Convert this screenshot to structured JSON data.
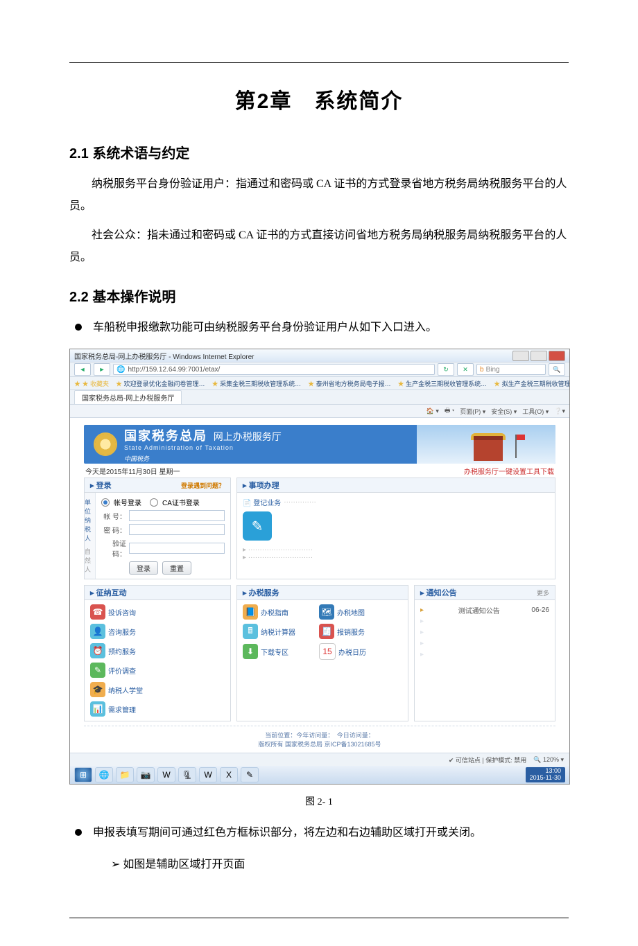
{
  "doc": {
    "chapter_title": "第2章　系统简介",
    "s21": "2.1 系统术语与约定",
    "p1": "纳税服务平台身份验证用户：指通过和密码或 CA 证书的方式登录省地方税务局纳税服务平台的人员。",
    "p2": "社会公众：指未通过和密码或 CA 证书的方式直接访问省地方税务局纳税服务局纳税服务平台的人员。",
    "s22": "2.2 基本操作说明",
    "b1": "车船税申报缴款功能可由纳税服务平台身份验证用户从如下入口进入。",
    "caption": "图 2- 1",
    "b2": "申报表填写期间可通过红色方框标识部分，将左边和右边辅助区域打开或关闭。",
    "sub1": "如图是辅助区域打开页面"
  },
  "win": {
    "title": "国家税务总局-网上办税服务厅 - Windows Internet Explorer",
    "url": "http://159.12.64.99:7001/etax/",
    "search_ph": "Bing",
    "tab": "国家税务总局-网上办税服务厅",
    "favs": [
      "欢迎登录优化金融问卷管理…",
      "采集金税三期税收管理系统…",
      "泰州省地方税务局电子报…",
      "生产金税三期税收管理系统…",
      "拟生产金税三期税收管理…"
    ],
    "tools": [
      "页面(P) ▾",
      "安全(S) ▾",
      "工具(O) ▾"
    ],
    "status": "可信站点 | 保护模式: 禁用",
    "zoom": "120%"
  },
  "site": {
    "title_cn": "国家税务总局",
    "title_en": "State Administration of Taxation",
    "hall": "网上办税服务厅",
    "brand": "中国税务",
    "date": "今天是2015年11月30日 星期一",
    "marquee": "办税服务厅一键设置工具下载",
    "login": {
      "head": "登录",
      "hint_btn": "登录遇到问题？",
      "left_tab_a": "单位纳税人",
      "left_tab_b": "自然人",
      "r1": "帐号登录",
      "r2": "CA证书登录",
      "l_user": "帐 号：",
      "l_pass": "密 码：",
      "l_code": "验证码：",
      "btn_login": "登录",
      "btn_reset": "重置"
    },
    "sxbl": {
      "head": "事项办理",
      "item": "登记业务"
    },
    "hd": {
      "head": "征纳互动",
      "items": [
        "投诉咨询",
        "咨询服务",
        "预约服务",
        "评价调查",
        "纳税人学堂",
        "需求管理"
      ]
    },
    "bs": {
      "head": "办税服务",
      "items": [
        "办税指南",
        "办税地图",
        "纳税计算器",
        "报销服务",
        "下载专区",
        "办税日历"
      ]
    },
    "gg": {
      "head": "通知公告",
      "more": "更多",
      "item": "测试通知公告",
      "date": "06-26"
    },
    "foot1": "当前位置：今年访问量：　今日访问量：",
    "foot2": "版权所有 国家税务总局 京ICP备13021685号"
  },
  "task": {
    "time": "13:00",
    "date": "2015-11-30"
  }
}
